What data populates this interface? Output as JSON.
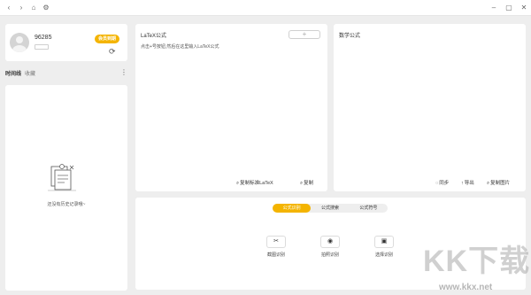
{
  "titlebar": {
    "back_icon": "‹",
    "forward_icon": "›",
    "home_icon": "⌂",
    "settings_icon": "⚙",
    "minimize_icon": "–",
    "maximize_icon": "▢",
    "close_icon": "✕"
  },
  "user": {
    "id": "96285",
    "vip_label": "会员到期"
  },
  "history": {
    "tab_history": "时间线",
    "tab_favorites": "收藏",
    "empty_text": "还没有历史记录哦~"
  },
  "latex_panel": {
    "title": "LaTeX公式",
    "hint": "点击+号按钮,然后在这里输入LaTeX公式",
    "add_icon": "+",
    "copy_standard": "复制标准LaTeX",
    "copy": "复制"
  },
  "math_panel": {
    "title": "数学公式",
    "sync": "同步",
    "export": "导出",
    "copy_image": "复制图片"
  },
  "tools": {
    "segments": [
      "公式识别",
      "公式搜索",
      "公式符号"
    ],
    "active_segment": 0,
    "buttons": [
      {
        "label": "截图识别",
        "icon": "✂"
      },
      {
        "label": "拍照识别",
        "icon": "◉"
      },
      {
        "label": "选择识别",
        "icon": "▣"
      }
    ]
  },
  "watermark": {
    "brand": "KK下载",
    "url": "www.kkx.net"
  },
  "colors": {
    "accent": "#f4b400",
    "background": "#eeeeee",
    "panel": "#ffffff"
  }
}
